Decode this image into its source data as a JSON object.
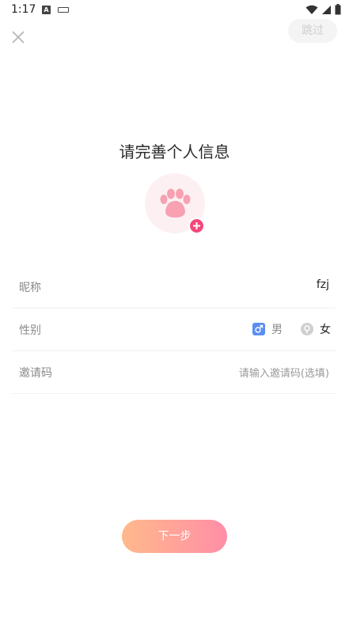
{
  "status_bar": {
    "time": "1:17",
    "notification_icon": "A",
    "icons": [
      "wifi-icon",
      "signal-icon",
      "battery-icon"
    ]
  },
  "header": {
    "close_icon": "close-icon",
    "skip_label": "跳过"
  },
  "page": {
    "title": "请完善个人信息"
  },
  "avatar": {
    "icon": "paw-icon",
    "add_icon": "plus-icon",
    "bg_color": "#fdf0f2",
    "accent_color": "#f4487c"
  },
  "form": {
    "nickname": {
      "label": "昵称",
      "value": "fzj"
    },
    "gender": {
      "label": "性别",
      "male_label": "男",
      "female_label": "女",
      "male_icon": "male-symbol-icon",
      "female_icon": "female-symbol-icon"
    },
    "invite": {
      "label": "邀请码",
      "placeholder": "请输入邀请码(选填)"
    }
  },
  "footer": {
    "next_label": "下一步",
    "gradient": [
      "#ffb98c",
      "#ff8ea6"
    ]
  }
}
